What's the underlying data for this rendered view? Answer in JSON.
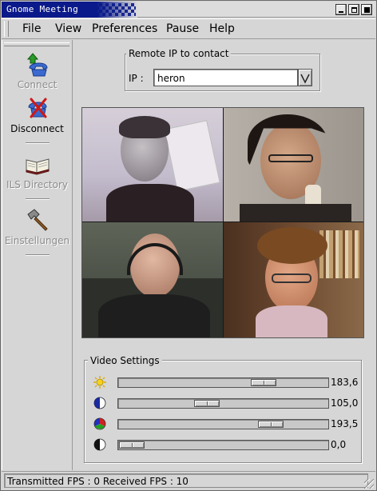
{
  "window": {
    "title": "Gnome Meeting"
  },
  "menubar": {
    "items": [
      "File",
      "View",
      "Preferences",
      "Pause",
      "Help"
    ]
  },
  "toolbar": {
    "connect": {
      "label": "Connect",
      "icon": "phone-connect-icon",
      "enabled": false
    },
    "disconnect": {
      "label": "Disconnect",
      "icon": "phone-disconnect-icon",
      "enabled": true
    },
    "ils": {
      "label": "ILS Directory",
      "icon": "book-icon",
      "enabled": false
    },
    "settings": {
      "label": "Einstellungen",
      "icon": "hammer-icon",
      "enabled": false
    }
  },
  "remote": {
    "frame_title": "Remote IP to contact",
    "ip_label": "IP :",
    "ip_value": "heron"
  },
  "video_settings": {
    "frame_title": "Video Settings",
    "sliders": [
      {
        "name": "brightness",
        "icon": "sun-icon",
        "value_label": "183,6",
        "level": 0.72
      },
      {
        "name": "whiteness",
        "icon": "half-moon-icon",
        "value_label": "105,0",
        "level": 0.41
      },
      {
        "name": "colour",
        "icon": "color-wheel-icon",
        "value_label": "193,5",
        "level": 0.76
      },
      {
        "name": "contrast",
        "icon": "contrast-icon",
        "value_label": "0,0",
        "level": 0.0
      }
    ]
  },
  "statusbar": {
    "text": "Transmitted FPS : 0  Received FPS : 10"
  },
  "colors": {
    "title_bar": "#0a1a8a",
    "window_bg": "#d6d6d6"
  }
}
